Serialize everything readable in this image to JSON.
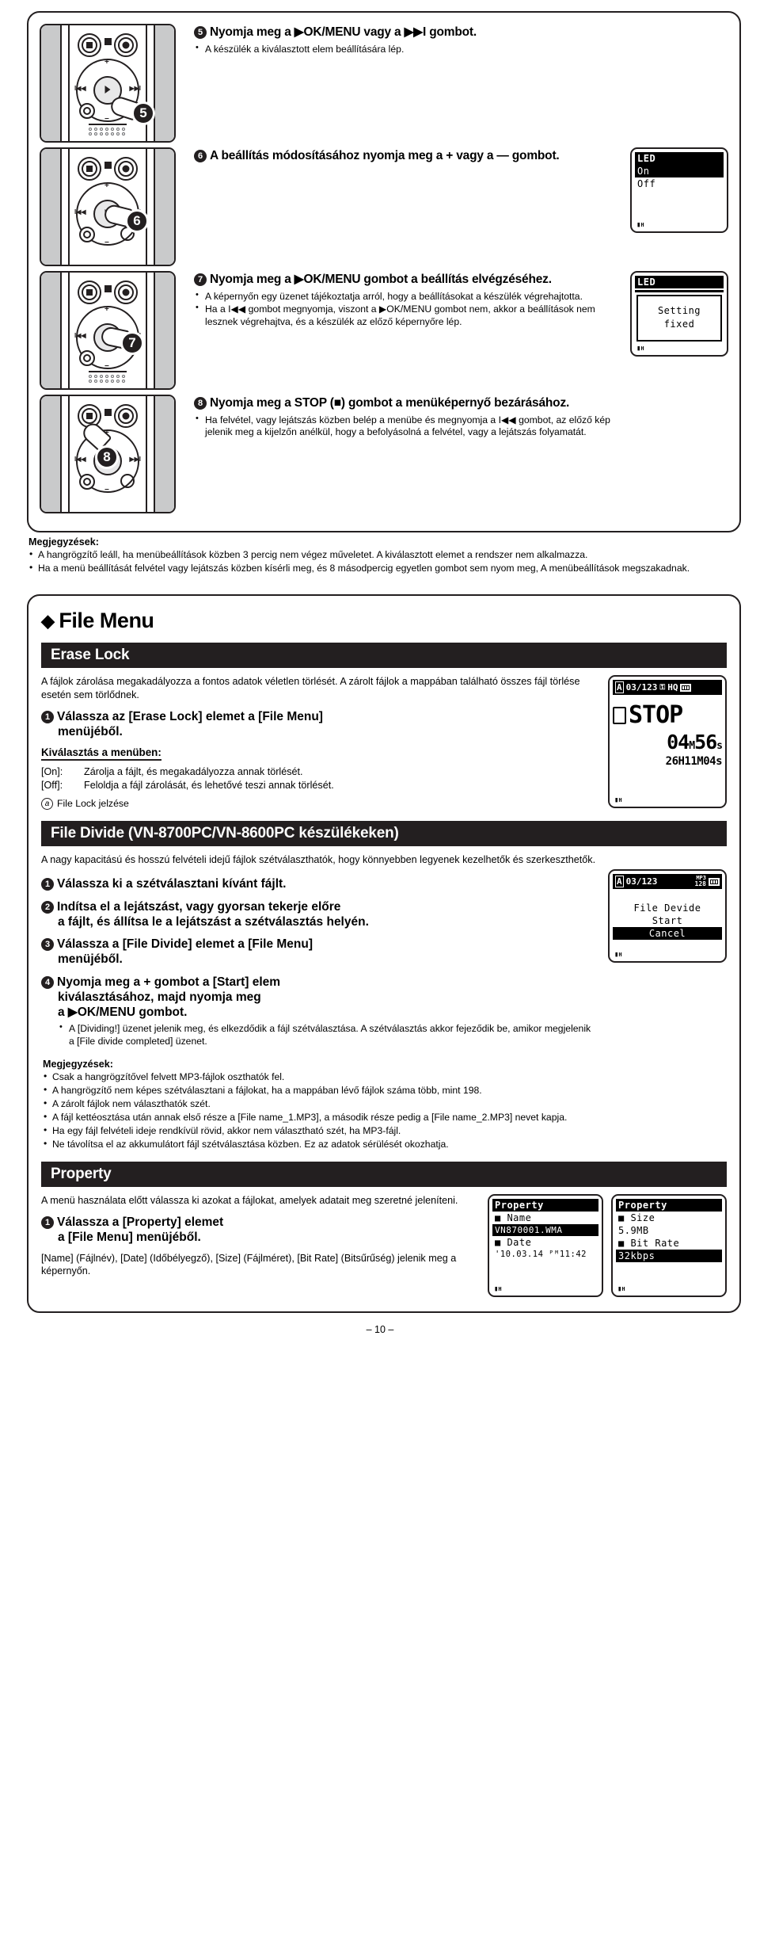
{
  "page_number": "– 10 –",
  "section_steps": {
    "step5": {
      "number": "5",
      "heading": "Nyomja meg a ▶OK/MENU vagy a ▶▶I gombot.",
      "bullets": [
        "A készülék a kiválasztott elem beállítására lép."
      ]
    },
    "step6": {
      "number": "6",
      "heading": "A beállítás módosításához nyomja meg a + vagy a — gombot.",
      "bullets": [],
      "lcd": {
        "title": "LED",
        "rows": [
          {
            "text": "On",
            "selected": true
          },
          {
            "text": "Off",
            "selected": false
          }
        ],
        "footer": "H"
      }
    },
    "step7": {
      "number": "7",
      "heading": "Nyomja meg a ▶OK/MENU gombot a beállítás elvégzéséhez.",
      "bullets": [
        "A képernyőn egy üzenet tájékoztatja arról, hogy a beállításokat a készülék végrehajtotta.",
        "Ha a I◀◀ gombot megnyomja, viszont a ▶OK/MENU gombot nem, akkor a beállítások nem lesznek végrehajtva, és a készülék az előző képernyőre lép."
      ],
      "lcd": {
        "title": "LED",
        "message_line1": "Setting",
        "message_line2": "fixed",
        "footer": "H"
      }
    },
    "step8": {
      "number": "8",
      "heading": "Nyomja meg a STOP (■) gombot a menüképernyő bezárásához.",
      "bullets": [
        "Ha felvétel, vagy lejátszás közben belép a menübe és megnyomja a I◀◀ gombot, az előző kép jelenik meg a kijelzőn anélkül, hogy a befolyásolná a felvétel, vagy a lejátszás folyamatát."
      ]
    },
    "notes": {
      "title": "Megjegyzések:",
      "items": [
        "A hangrögzítő leáll, ha menübeállítások közben 3 percig nem végez műveletet. A kiválasztott elemet a rendszer nem alkalmazza.",
        "Ha a menü beállítását felvétel vagy lejátszás közben kísérli meg, és 8 másodpercig egyetlen gombot sem nyom meg, A menübeállítások megszakadnak."
      ]
    }
  },
  "file_menu": {
    "title": "File Menu",
    "diamond": "◆",
    "erase_lock": {
      "bar": "Erase Lock",
      "intro": "A fájlok zárolása megakadályozza a fontos adatok véletlen törlését. A zárolt fájlok a mappában található összes fájl törlése esetén sem törlődnek.",
      "step": {
        "number": "1",
        "line1": "Válassza az [Erase Lock] elemet a [File Menu]",
        "line2": "menüjéből."
      },
      "subhead": "Kiválasztás a menüben:",
      "options": [
        {
          "key": "[On]:",
          "desc": "Zárolja a fájlt, és megakadályozza annak törlését."
        },
        {
          "key": "[Off]:",
          "desc": "Feloldja a fájl zárolását, és lehetővé teszi annak törlését."
        }
      ],
      "legend_marker": "a",
      "legend_text": "File Lock jelzése",
      "lcd": {
        "folder": "A",
        "file_index": "03/123",
        "quality": "HQ",
        "status": "STOP",
        "elapsed_min": "04",
        "elapsed_min_unit": "M",
        "elapsed_sec": "56",
        "elapsed_sec_unit": "s",
        "remaining": "26H11M04s",
        "footer": "H"
      }
    },
    "file_divide": {
      "bar": "File Divide (VN-8700PC/VN-8600PC készülékeken)",
      "intro": "A nagy kapacitású és hosszú felvételi idejű fájlok szétválaszthatók, hogy könnyebben legyenek kezelhetők és szerkeszthetők.",
      "steps": [
        {
          "number": "1",
          "lines": [
            "Válassza ki a szétválasztani kívánt fájlt."
          ],
          "bullets": []
        },
        {
          "number": "2",
          "lines": [
            "Indítsa el a lejátszást, vagy gyorsan tekerje előre",
            "a fájlt, és állítsa le a lejátszást a szétválasztás helyén."
          ],
          "bullets": []
        },
        {
          "number": "3",
          "lines": [
            "Válassza a [File Divide] elemet a [File Menu]",
            "menüjéből."
          ],
          "bullets": []
        },
        {
          "number": "4",
          "lines": [
            "Nyomja meg a + gombot a [Start] elem",
            "kiválasztásához, majd nyomja meg",
            "a ▶OK/MENU gombot."
          ],
          "bullets": [
            "A [Dividing!] üzenet jelenik meg, és elkezdődik a fájl szétválasztása. A szétválasztás akkor fejeződik be, amikor megjelenik a [File divide completed] üzenet."
          ]
        }
      ],
      "lcd": {
        "folder": "A",
        "file_index": "03/123",
        "format": "MP3",
        "bitrate": "128",
        "title": "File Devide",
        "rows": [
          {
            "text": "Start",
            "selected": false
          },
          {
            "text": "Cancel",
            "selected": true
          }
        ],
        "footer": "H"
      },
      "notes": {
        "title": "Megjegyzések:",
        "items": [
          "Csak a hangrögzítővel felvett MP3-fájlok oszthatók fel.",
          "A hangrögzítő nem képes szétválasztani a fájlokat, ha a mappában lévő fájlok száma több, mint 198.",
          "A zárolt fájlok nem választhatók szét.",
          "A fájl kettéosztása után annak első része a [File name_1.MP3], a második része pedig a [File name_2.MP3] nevet kapja.",
          "Ha egy fájl felvételi ideje rendkívül rövid, akkor nem választható szét, ha MP3-fájl.",
          "Ne távolítsa el az akkumulátort fájl szétválasztása közben. Ez az adatok sérülését okozhatja."
        ]
      }
    },
    "property": {
      "bar": "Property",
      "intro": "A menü használata előtt válassza ki azokat a fájlokat, amelyek adatait meg szeretné jeleníteni.",
      "step": {
        "number": "1",
        "line1": "Válassza a [Property] elemet",
        "line2": "a [File Menu] menüjéből."
      },
      "footer_text": "[Name] (Fájlnév), [Date] (Időbélyegző), [Size] (Fájlméret), [Bit Rate] (Bitsűrűség) jelenik meg a képernyőn.",
      "lcd_left": {
        "title": "Property",
        "rows": [
          {
            "text": "Name",
            "selected": false,
            "bullet": true
          },
          {
            "text": "VN870001.WMA",
            "selected": true,
            "bullet": false
          },
          {
            "text": "Date",
            "selected": false,
            "bullet": true
          },
          {
            "text": "'10.03.14 ᴾᴹ11:42",
            "selected": false,
            "bullet": false
          }
        ],
        "footer": "H"
      },
      "lcd_right": {
        "title": "Property",
        "rows": [
          {
            "text": "Size",
            "selected": false,
            "bullet": true
          },
          {
            "text": "5.9MB",
            "selected": false,
            "bullet": false
          },
          {
            "text": "Bit Rate",
            "selected": false,
            "bullet": true
          },
          {
            "text": "32kbps",
            "selected": true,
            "bullet": false
          }
        ],
        "footer": "H"
      }
    }
  }
}
